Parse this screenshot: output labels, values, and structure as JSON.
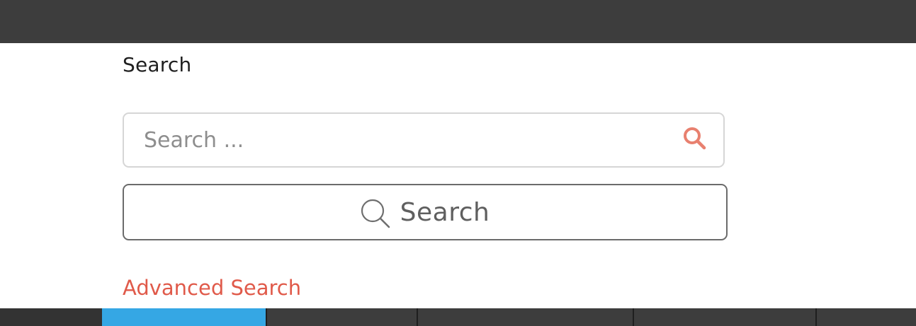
{
  "heading": "Search",
  "search": {
    "placeholder": "Search ...",
    "value": ""
  },
  "search_button_label": "Search",
  "advanced_link": "Advanced Search",
  "icons": {
    "field_icon": "search-icon",
    "button_icon": "search-icon"
  },
  "colors": {
    "top_bar": "#3d3d3d",
    "accent_link": "#e05a4a",
    "field_icon": "#e8806f",
    "nav_active": "#35a7e4"
  }
}
